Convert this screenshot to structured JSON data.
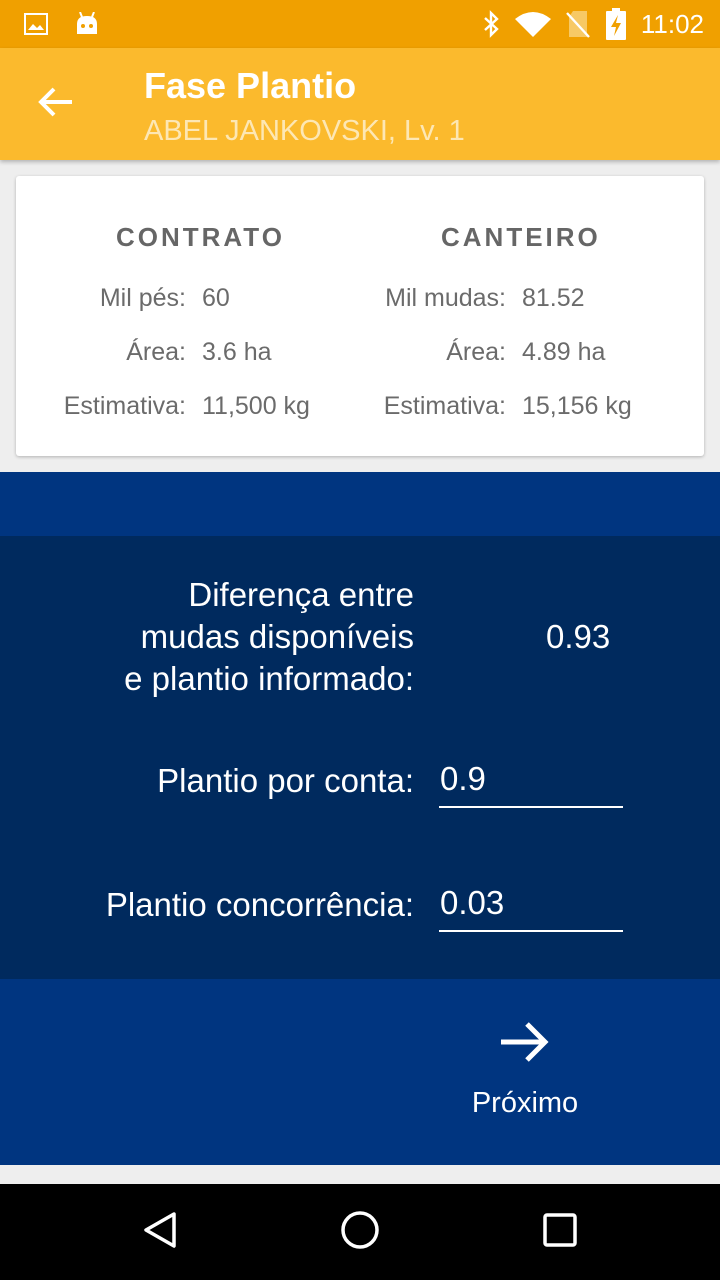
{
  "status_bar": {
    "time": "11:02",
    "icons": [
      "image-icon",
      "android-icon",
      "bluetooth-icon",
      "wifi-icon",
      "no-sim-icon",
      "battery-charging-icon"
    ]
  },
  "app_bar": {
    "title": "Fase Plantio",
    "subtitle": "ABEL JANKOVSKI, Lv. 1",
    "back_icon": "arrow-left-icon"
  },
  "summary": {
    "contrato": {
      "title": "CONTRATO",
      "rows": [
        {
          "label": "Mil pés:",
          "value": "60"
        },
        {
          "label": "Área:",
          "value": "3.6 ha"
        },
        {
          "label": "Estimativa:",
          "value": "11,500 kg"
        }
      ]
    },
    "canteiro": {
      "title": "CANTEIRO",
      "rows": [
        {
          "label": "Mil mudas:",
          "value": "81.52"
        },
        {
          "label": "Área:",
          "value": "4.89 ha"
        },
        {
          "label": "Estimativa:",
          "value": "15,156 kg"
        }
      ]
    }
  },
  "form": {
    "difference": {
      "label_line1": "Diferença entre",
      "label_line2": "mudas disponíveis",
      "label_line3": "e plantio informado:",
      "value": "0.93"
    },
    "plantio_conta": {
      "label": "Plantio por conta:",
      "value": "0.9"
    },
    "plantio_concorrencia": {
      "label": "Plantio concorrência:",
      "value": "0.03"
    }
  },
  "actions": {
    "next_label": "Próximo",
    "next_icon": "arrow-right-icon"
  },
  "nav_bar": {
    "buttons": [
      "back-triangle-icon",
      "home-circle-icon",
      "recents-square-icon"
    ]
  },
  "colors": {
    "status_bar": "#F0A000",
    "app_bar": "#FBBA2D",
    "navy": "#002A5E",
    "blue": "#003580"
  }
}
